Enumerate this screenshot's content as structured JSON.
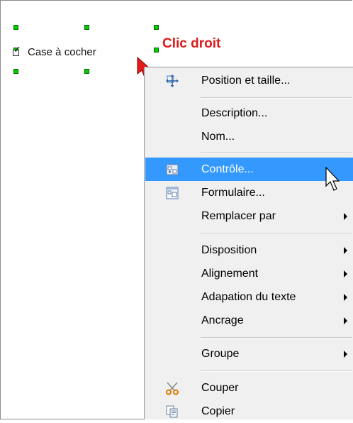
{
  "canvas": {
    "control_label": "Case à cocher",
    "annotation": "Clic droit"
  },
  "menu": {
    "position_label": "Position et taille...",
    "description_label": "Description...",
    "nom_label": "Nom...",
    "controle_label": "Contrôle...",
    "formulaire_label": "Formulaire...",
    "remplacer_label": "Remplacer par",
    "disposition_label": "Disposition",
    "alignement_label": "Alignement",
    "adaptation_label": "Adapation du texte",
    "ancrage_label": "Ancrage",
    "groupe_label": "Groupe",
    "couper_label": "Couper",
    "copier_label": "Copier",
    "highlighted": "Contrôle...",
    "highlight_color": "#3399ff"
  },
  "icons": {
    "position": "move-arrows-icon",
    "controle": "control-properties-icon",
    "formulaire": "form-icon",
    "couper": "scissors-icon",
    "copier": "copy-icon",
    "submenu": "submenu-arrow-icon"
  },
  "colors": {
    "annotation": "#e01a1a",
    "handle": "#00cc00"
  }
}
